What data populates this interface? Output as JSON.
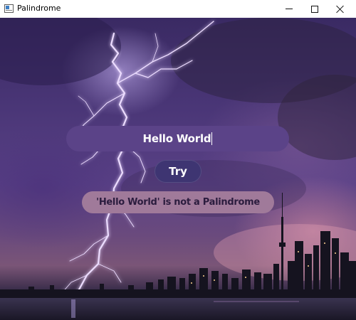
{
  "window": {
    "title": "Palindrome",
    "icon": "app-window-icon",
    "controls": [
      "minimize-icon",
      "maximize-icon",
      "close-icon"
    ]
  },
  "main": {
    "input": {
      "value": "Hello World",
      "placeholder": ""
    },
    "try_button_label": "Try",
    "result_text": "'Hello World' is not a Palindrome"
  },
  "colors": {
    "input_bg": "#5b4388",
    "button_bg": "#3e3572",
    "result_bg": "#a07a9a",
    "result_text": "#2b1c3e"
  }
}
